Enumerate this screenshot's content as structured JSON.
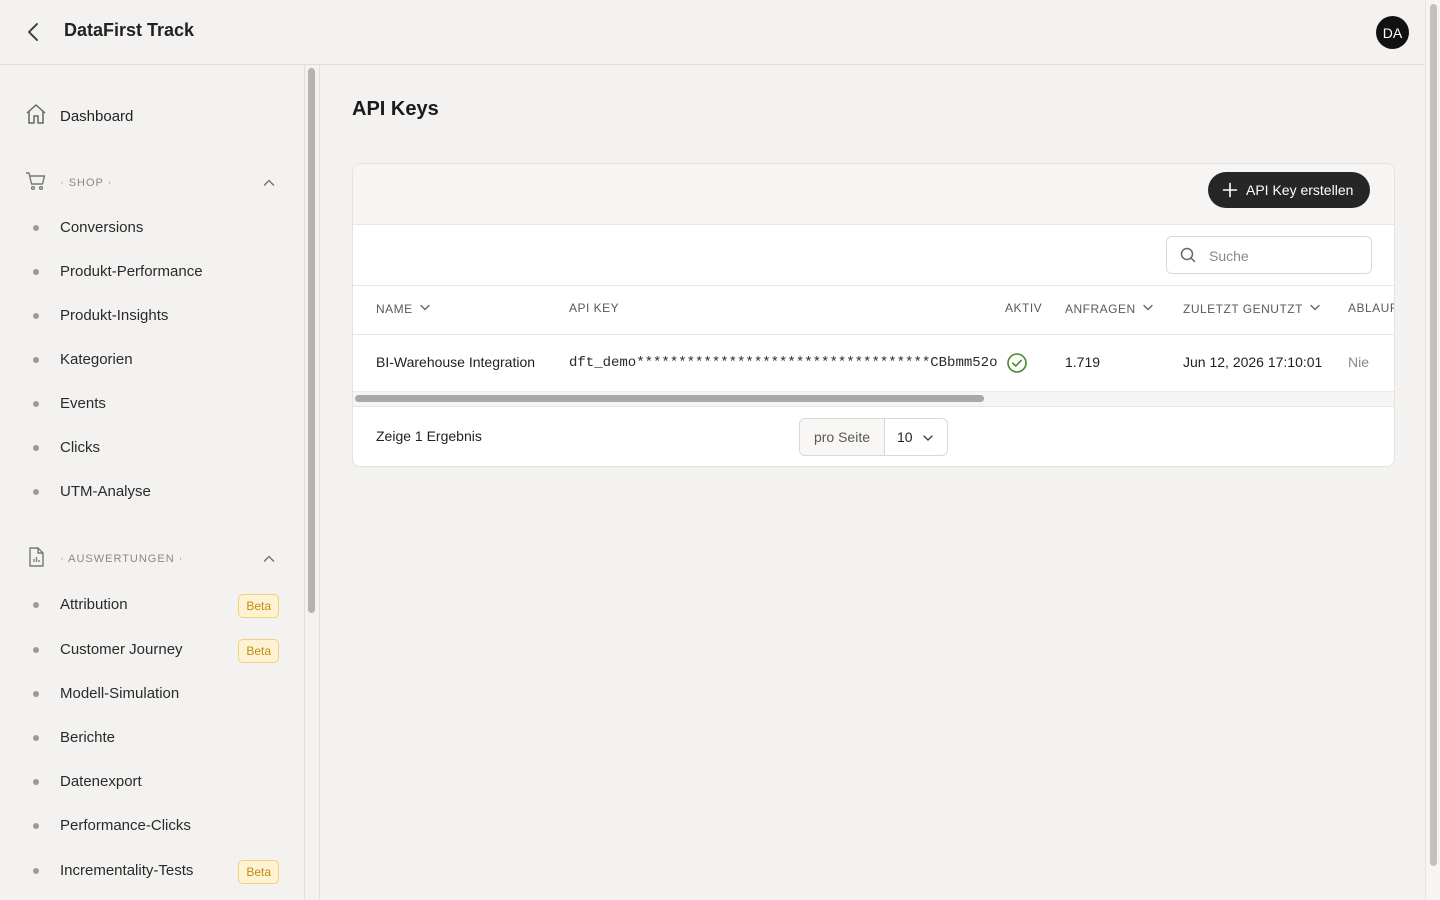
{
  "header": {
    "title": "DataFirst Track",
    "avatar_initials": "DA"
  },
  "sidebar": {
    "dashboard": {
      "label": "Dashboard",
      "icon": "home-icon"
    },
    "sections": [
      {
        "label": "· SHOP ·",
        "icon": "cart-icon",
        "items": [
          {
            "label": "Conversions"
          },
          {
            "label": "Produkt-Performance"
          },
          {
            "label": "Produkt-Insights"
          },
          {
            "label": "Kategorien"
          },
          {
            "label": "Events"
          },
          {
            "label": "Clicks"
          },
          {
            "label": "UTM-Analyse"
          }
        ]
      },
      {
        "label": "· AUSWERTUNGEN ·",
        "icon": "report-icon",
        "items": [
          {
            "label": "Attribution",
            "badge": "Beta"
          },
          {
            "label": "Customer Journey",
            "badge": "Beta"
          },
          {
            "label": "Modell-Simulation"
          },
          {
            "label": "Berichte"
          },
          {
            "label": "Datenexport"
          },
          {
            "label": "Performance-Clicks"
          },
          {
            "label": "Incrementality-Tests",
            "badge": "Beta"
          }
        ]
      }
    ]
  },
  "main": {
    "title": "API Keys",
    "create_button": "API Key erstellen",
    "search_placeholder": "Suche",
    "table": {
      "columns": [
        "NAME",
        "API KEY",
        "AKTIV",
        "ANFRAGEN",
        "ZULETZT GENUTZT",
        "ABLAUF"
      ],
      "rows": [
        {
          "name": "BI-Warehouse Integration",
          "api_key": "dft_demo***********************************CBbmm52o",
          "active": true,
          "requests": "1.719",
          "last_used": "Jun 12, 2026 17:10:01",
          "expires": "Nie"
        }
      ]
    },
    "footer": {
      "result_text": "Zeige 1 Ergebnis",
      "per_page_label": "pro Seite",
      "per_page_value": "10"
    }
  },
  "colors": {
    "accent_dark": "#262626",
    "active_green": "#4a8a2a",
    "badge_bg": "#fdf3d3",
    "badge_text": "#c28a12"
  }
}
